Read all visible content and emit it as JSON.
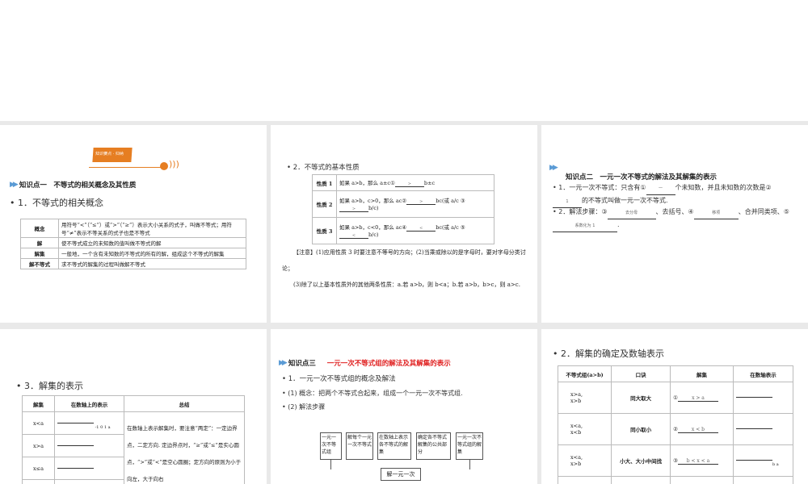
{
  "slide1": {
    "badge": "知识要点 · 归纳",
    "kp_title": "知识点一　不等式的相关概念及其性质",
    "heading": "1．不等式的相关概念",
    "rows": [
      {
        "k": "概念",
        "v": "用符号“<”（“≤”）或“>”（“≥”）表示大小关系的式子，叫做不等式；用符号“≠”表示不等关系的式子也是不等式"
      },
      {
        "k": "解",
        "v": "使不等式成立的未知数的值叫做不等式的解"
      },
      {
        "k": "解集",
        "v": "一般地，一个含有未知数的不等式的所有的解，组成这个不等式的解集"
      },
      {
        "k": "解不等式",
        "v": "求不等式的解集的过程叫做解不等式"
      }
    ]
  },
  "slide2": {
    "heading": "2．不等式的基本性质",
    "rows": [
      {
        "k": "性质 1",
        "v": "如果 a>b，那么 a±c①",
        "a1": ">",
        "tail": "b±c"
      },
      {
        "k": "性质 2",
        "v": "如果 a>b，c>0，那么 ac②",
        "a1": ">",
        "mid": "bc(或 a/c ③",
        "a2": ">",
        "tail": "b/c)"
      },
      {
        "k": "性质 3",
        "v": "如果 a>b，c<0，那么 ac④",
        "a1": "<",
        "mid": "bc(或 a/c ⑤",
        "a2": "<",
        "tail": "b/c)"
      }
    ],
    "note1": "【注意】(1)应用性质 3 时要注意不等号的方向；(2)当乘或除以的是字母时，要对字母分类讨论；",
    "note2": "(3)除了以上基本性质外的其他两条性质：a.若 a>b，则 b<a；b.若 a>b，b>c，则 a>c."
  },
  "slide3": {
    "kp_title": "知识点二　一元一次不等式的解法及其解集的表示",
    "l1a": "1．一元一次不等式：只含有①",
    "a1": "一",
    "l1b": "个未知数，并且未知数的次数是②",
    "a2": "1",
    "l1c": "的不等式叫做一元一次不等式.",
    "l2a": "2．解法步骤：③",
    "a3": "去分母",
    "l2b": "、去括号、④",
    "a4": "移项",
    "l2c": "、合并同类项、⑤",
    "a5": "系数化为 1",
    "l2d": "."
  },
  "slide4": {
    "heading": "3．解集的表示",
    "headers": [
      "解集",
      "在数轴上的表示",
      "总结"
    ],
    "sets": [
      "x<a",
      "x>a",
      "x≤a"
    ],
    "ticks": [
      "-1",
      "0",
      "1",
      "a"
    ],
    "summary": "在数轴上表示解集时，要注意“两定”：一定边界点，二定方向. 定边界点时，“≥”或“≤”是实心圆点，“>”或“<”是空心圆圈；定方向的原则为小于向左，大于向右"
  },
  "slide5": {
    "kp_title": "知识点三",
    "kp_title_red": "一元一次不等式组的解法及其解集的表示",
    "b1": "1．一元一次不等式组的概念及解法",
    "b2": "(1) 概念：把两个不等式合起来，组成一个一元一次不等式组.",
    "b3": "(2) 解法步骤",
    "flow": [
      "一元一次不等式组",
      "解每个一元一次不等式",
      "在数轴上表示各不等式的解集",
      "确定各不等式解集的公共部分",
      "一元一次不等式组的解集"
    ],
    "flow_bottom": "解一元一次"
  },
  "slide6": {
    "heading": "2．解集的确定及数轴表示",
    "headers": [
      "不等式组(a>b)",
      "口诀",
      "解集",
      "在数轴表示"
    ],
    "rows": [
      {
        "sys": [
          "x>a,",
          "x>b"
        ],
        "rule": "同大取大",
        "n": "①",
        "ans": "x > a"
      },
      {
        "sys": [
          "x<a,",
          "x<b"
        ],
        "rule": "同小取小",
        "n": "②",
        "ans": "x < b"
      },
      {
        "sys": [
          "x<a,",
          "x>b"
        ],
        "rule": "小大、大小中间找",
        "n": "③",
        "ans": "b < x < a"
      }
    ],
    "axis_labels": [
      "b",
      "a"
    ]
  }
}
